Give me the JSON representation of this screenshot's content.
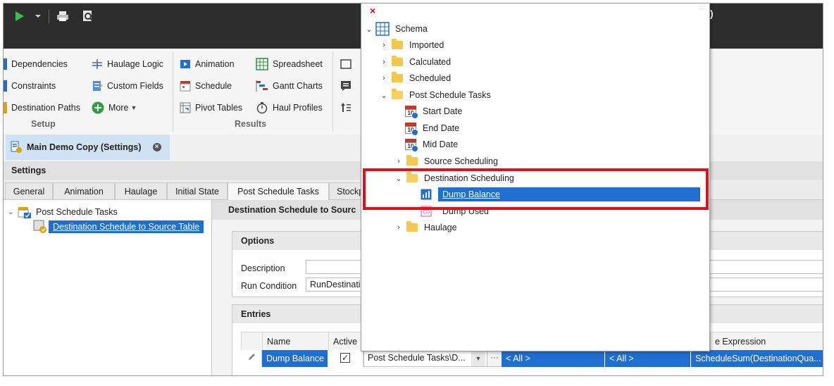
{
  "title_suffix": ")",
  "ribbon": {
    "setup": {
      "group_label": "Setup",
      "items": [
        {
          "label": "Dependencies",
          "icon": "dependencies-icon"
        },
        {
          "label": "Constraints",
          "icon": "constraints-icon"
        },
        {
          "label": "Destination Paths",
          "icon": "destination-paths-icon"
        },
        {
          "label": "Haulage Logic",
          "icon": "haulage-logic-icon"
        },
        {
          "label": "Custom Fields",
          "icon": "custom-fields-icon"
        },
        {
          "label": "More",
          "icon": "plus-circle-icon"
        }
      ]
    },
    "results": {
      "group_label": "Results",
      "items": [
        {
          "label": "Animation",
          "icon": "animation-icon"
        },
        {
          "label": "Schedule",
          "icon": "schedule-icon"
        },
        {
          "label": "Pivot Tables",
          "icon": "pivot-tables-icon"
        },
        {
          "label": "Spreadsheet",
          "icon": "spreadsheet-icon"
        },
        {
          "label": "Gantt Charts",
          "icon": "gantt-charts-icon"
        },
        {
          "label": "Haul Profiles",
          "icon": "stopwatch-icon"
        }
      ]
    }
  },
  "doc_tab": {
    "label": "Main Demo Copy (Settings)"
  },
  "settings_header": "Settings",
  "tabs": [
    "General",
    "Animation",
    "Haulage",
    "Initial State",
    "Post Schedule Tasks",
    "Stockp"
  ],
  "left_tree": {
    "root": "Post Schedule Tasks",
    "child": "Destination Schedule to Source Table"
  },
  "content": {
    "title": "Destination Schedule to Sourc",
    "options": {
      "header": "Options",
      "description_label": "Description",
      "description_value": "",
      "run_condition_label": "Run Condition",
      "run_condition_value": "RunDestination"
    },
    "entries": {
      "header": "Entries",
      "columns": {
        "name": "Name",
        "active": "Active",
        "expression": "e Expression"
      },
      "row": {
        "name": "Dump Balance",
        "active": true,
        "path": "Post Schedule Tasks\\D...",
        "all1": "< All >",
        "all2": "< All >",
        "expression": "ScheduleSum(DestinationQua..."
      }
    }
  },
  "popup": {
    "close": "×",
    "tree": [
      {
        "label": "Schema",
        "level": 0,
        "icon": "schema-icon",
        "expanded": true
      },
      {
        "label": "Imported",
        "level": 1,
        "icon": "folder-icon",
        "expanded": false
      },
      {
        "label": "Calculated",
        "level": 1,
        "icon": "folder-icon",
        "expanded": false
      },
      {
        "label": "Scheduled",
        "level": 1,
        "icon": "folder-icon",
        "expanded": false
      },
      {
        "label": "Post Schedule Tasks",
        "level": 1,
        "icon": "folder-open-icon",
        "expanded": true
      },
      {
        "label": "Start Date",
        "level": 2,
        "icon": "calendar-icon"
      },
      {
        "label": "End Date",
        "level": 2,
        "icon": "calendar-icon"
      },
      {
        "label": "Mid Date",
        "level": 2,
        "icon": "calendar-icon"
      },
      {
        "label": "Source Scheduling",
        "level": 2,
        "icon": "folder-icon",
        "expanded": false
      },
      {
        "label": "Destination Scheduling",
        "level": 2,
        "icon": "folder-open-icon",
        "expanded": true
      },
      {
        "label": "Dump Balance",
        "level": 3,
        "icon": "numeric-field-icon",
        "selected": true
      },
      {
        "label": "Dump Used",
        "level": 3,
        "icon": "text-field-icon"
      },
      {
        "label": "Haulage",
        "level": 2,
        "icon": "folder-icon",
        "expanded": false
      }
    ]
  },
  "colors": {
    "selection": "#1e6fd0",
    "highlight_box": "#e0101a",
    "titlebar": "#2d2d2d"
  }
}
